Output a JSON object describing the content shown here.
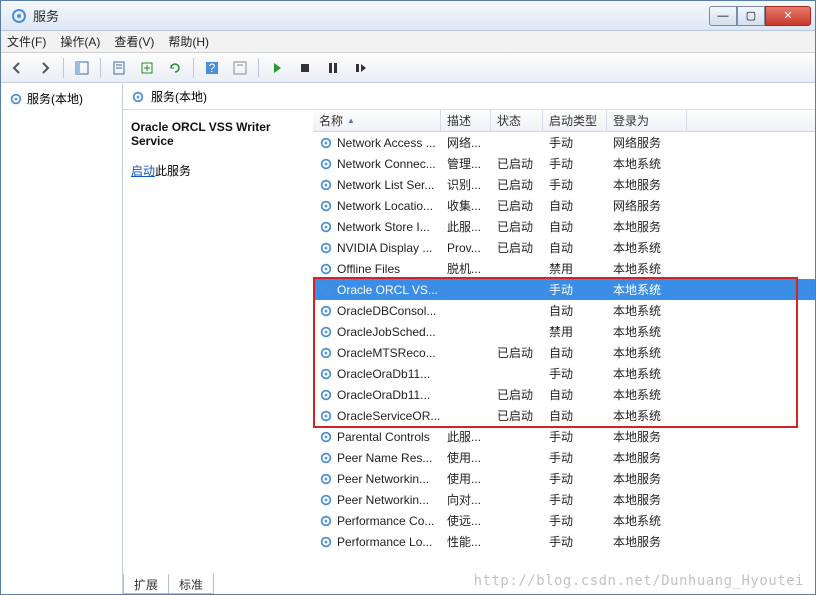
{
  "window": {
    "title": "服务"
  },
  "menu": {
    "file": "文件(F)",
    "action": "操作(A)",
    "view": "查看(V)",
    "help": "帮助(H)"
  },
  "left": {
    "root": "服务(本地)"
  },
  "header": {
    "title": "服务(本地)"
  },
  "desc": {
    "title": "Oracle ORCL VSS Writer Service",
    "start_link": "启动",
    "start_suffix": "此服务"
  },
  "columns": {
    "name": "名称",
    "desc": "描述",
    "status": "状态",
    "startup": "启动类型",
    "logon": "登录为"
  },
  "tabs": {
    "extended": "扩展",
    "standard": "标准"
  },
  "rows": [
    {
      "name": "Network Access ...",
      "desc": "网络...",
      "status": "",
      "startup": "手动",
      "logon": "网络服务",
      "selected": false
    },
    {
      "name": "Network Connec...",
      "desc": "管理...",
      "status": "已启动",
      "startup": "手动",
      "logon": "本地系统",
      "selected": false
    },
    {
      "name": "Network List Ser...",
      "desc": "识别...",
      "status": "已启动",
      "startup": "手动",
      "logon": "本地服务",
      "selected": false
    },
    {
      "name": "Network Locatio...",
      "desc": "收集...",
      "status": "已启动",
      "startup": "自动",
      "logon": "网络服务",
      "selected": false
    },
    {
      "name": "Network Store I...",
      "desc": "此服...",
      "status": "已启动",
      "startup": "自动",
      "logon": "本地服务",
      "selected": false
    },
    {
      "name": "NVIDIA Display ...",
      "desc": "Prov...",
      "status": "已启动",
      "startup": "自动",
      "logon": "本地系统",
      "selected": false
    },
    {
      "name": "Offline Files",
      "desc": "脱机...",
      "status": "",
      "startup": "禁用",
      "logon": "本地系统",
      "selected": false
    },
    {
      "name": "Oracle ORCL VS...",
      "desc": "",
      "status": "",
      "startup": "手动",
      "logon": "本地系统",
      "selected": true
    },
    {
      "name": "OracleDBConsol...",
      "desc": "",
      "status": "",
      "startup": "自动",
      "logon": "本地系统",
      "selected": false
    },
    {
      "name": "OracleJobSched...",
      "desc": "",
      "status": "",
      "startup": "禁用",
      "logon": "本地系统",
      "selected": false
    },
    {
      "name": "OracleMTSReco...",
      "desc": "",
      "status": "已启动",
      "startup": "自动",
      "logon": "本地系统",
      "selected": false
    },
    {
      "name": "OracleOraDb11...",
      "desc": "",
      "status": "",
      "startup": "手动",
      "logon": "本地系统",
      "selected": false
    },
    {
      "name": "OracleOraDb11...",
      "desc": "",
      "status": "已启动",
      "startup": "自动",
      "logon": "本地系统",
      "selected": false
    },
    {
      "name": "OracleServiceOR...",
      "desc": "",
      "status": "已启动",
      "startup": "自动",
      "logon": "本地系统",
      "selected": false
    },
    {
      "name": "Parental Controls",
      "desc": "此服...",
      "status": "",
      "startup": "手动",
      "logon": "本地服务",
      "selected": false
    },
    {
      "name": "Peer Name Res...",
      "desc": "使用...",
      "status": "",
      "startup": "手动",
      "logon": "本地服务",
      "selected": false
    },
    {
      "name": "Peer Networkin...",
      "desc": "使用...",
      "status": "",
      "startup": "手动",
      "logon": "本地服务",
      "selected": false
    },
    {
      "name": "Peer Networkin...",
      "desc": "向对...",
      "status": "",
      "startup": "手动",
      "logon": "本地服务",
      "selected": false
    },
    {
      "name": "Performance Co...",
      "desc": "使远...",
      "status": "",
      "startup": "手动",
      "logon": "本地系统",
      "selected": false
    },
    {
      "name": "Performance Lo...",
      "desc": "性能...",
      "status": "",
      "startup": "手动",
      "logon": "本地服务",
      "selected": false
    }
  ],
  "watermark": "http://blog.csdn.net/Dunhuang_Hyoutei",
  "redbox": {
    "top_row": 7,
    "bottom_row": 13
  }
}
